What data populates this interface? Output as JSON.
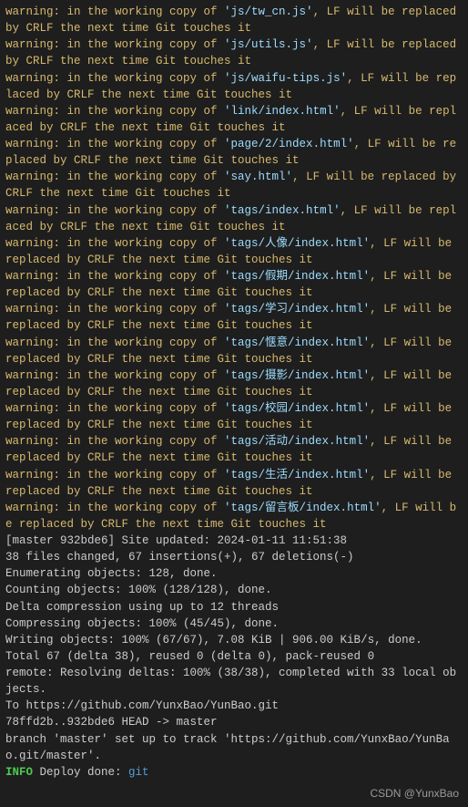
{
  "strings": {
    "warn_prefix": "warning: in the working copy of ",
    "warn_suffix": ", LF will be replaced by CRLF the next time Git touches it"
  },
  "warnings": [
    "'js/tw_cn.js'",
    "'js/utils.js'",
    "'js/waifu-tips.js'",
    "'link/index.html'",
    "'page/2/index.html'",
    "'say.html'",
    "'tags/index.html'",
    "'tags/人像/index.html'",
    "'tags/假期/index.html'",
    "'tags/学习/index.html'",
    "'tags/惬意/index.html'",
    "'tags/摄影/index.html'",
    "'tags/校园/index.html'",
    "'tags/活动/index.html'",
    "'tags/生活/index.html'",
    "'tags/留言板/index.html'"
  ],
  "commit": {
    "summary": "[master 932bde6] Site updated: 2024-01-11 11:51:38",
    "stats": " 38 files changed, 67 insertions(+), 67 deletions(-)"
  },
  "progress": [
    "Enumerating objects: 128, done.",
    "Counting objects: 100% (128/128), done.",
    "Delta compression using up to 12 threads",
    "Compressing objects: 100% (45/45), done.",
    "Writing objects: 100% (67/67), 7.08 KiB | 906.00 KiB/s, done.",
    "Total 67 (delta 38), reused 0 (delta 0), pack-reused 0",
    "remote: Resolving deltas: 100% (38/38), completed with 33 local objects."
  ],
  "push": {
    "to": "To https://github.com/YunxBao/YunBao.git",
    "ref": "   78ffd2b..932bde6  HEAD -> master",
    "track": "branch 'master' set up to track 'https://github.com/YunxBao/YunBao.git/master'."
  },
  "done": {
    "info": "INFO ",
    "text": " Deploy done: ",
    "tool": "git"
  },
  "watermark": "CSDN @YunxBao"
}
